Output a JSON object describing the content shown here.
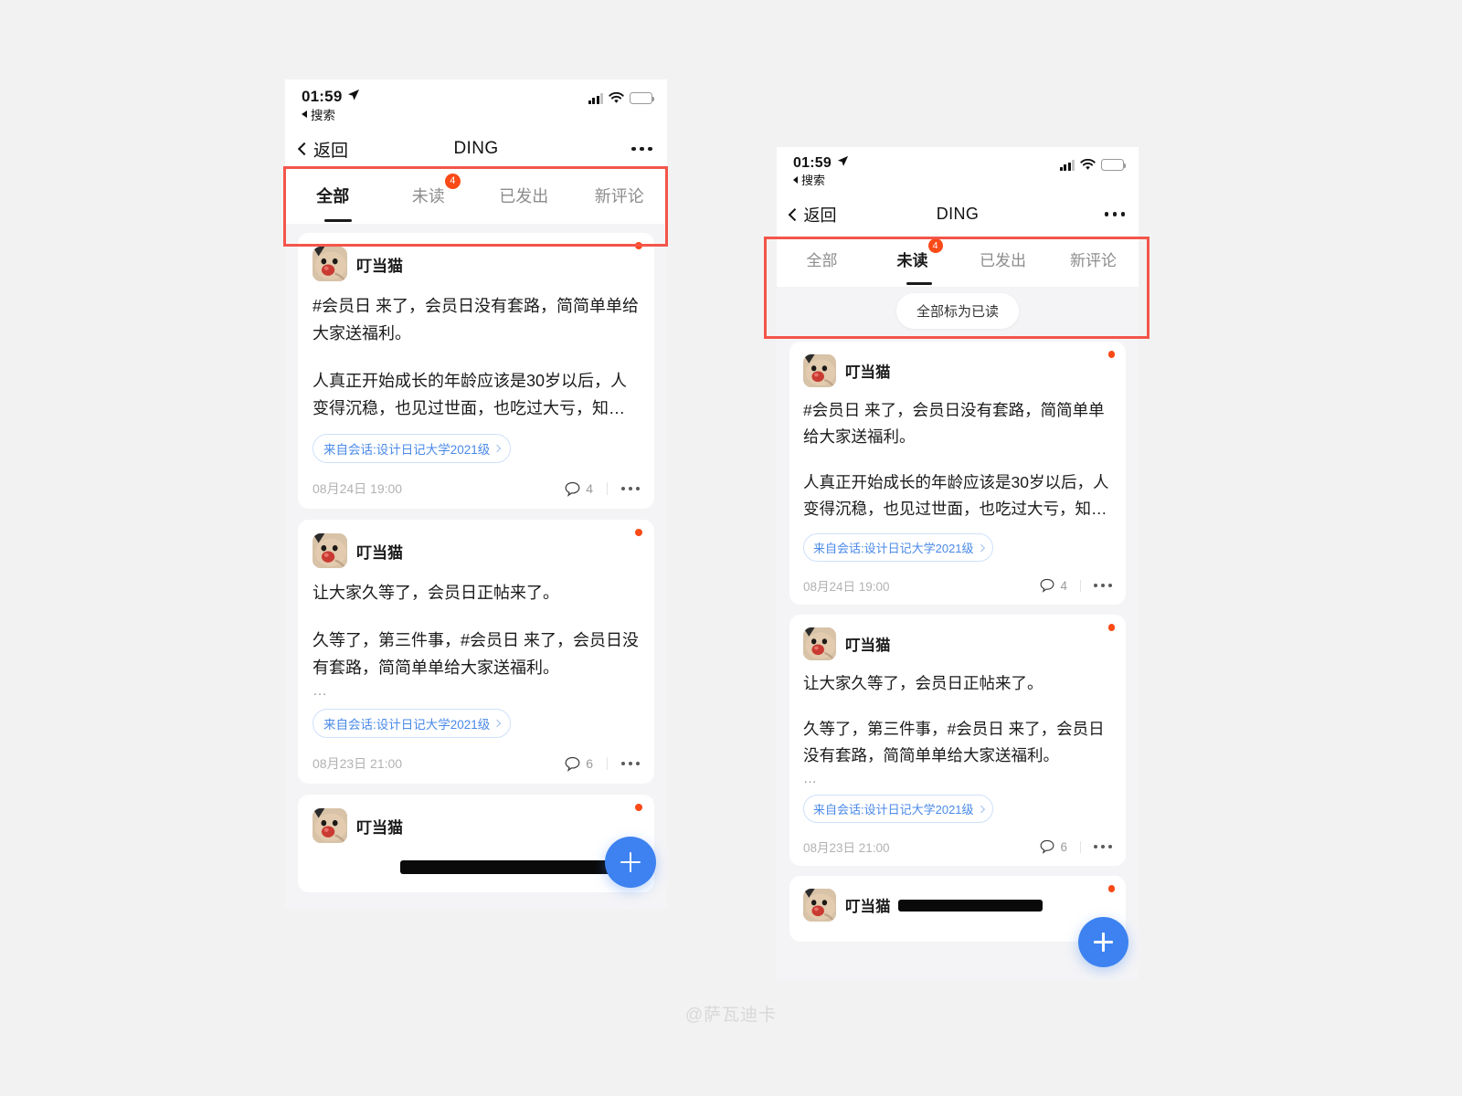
{
  "page": {
    "watermark": "@萨瓦迪卡",
    "accent_blue": "#3d82f0",
    "badge_orange": "#fa4a17",
    "annotation_red": "#f4554a",
    "background": "#f2f2f2"
  },
  "status_bar": {
    "time": "01:59",
    "location_icon": "location-arrow-icon",
    "back_label": "搜索",
    "back_icon": "back-triangle-icon",
    "signal_icon": "cellular-signal-icon",
    "wifi_icon": "wifi-icon",
    "battery_icon": "battery-charging-icon"
  },
  "nav": {
    "back_label": "返回",
    "back_icon": "chevron-left-icon",
    "title": "DING",
    "more_icon": "more-horizontal-icon"
  },
  "tabs": [
    {
      "label": "全部",
      "badge": "",
      "active_left": true,
      "active_right": false
    },
    {
      "label": "未读",
      "badge": "4",
      "active_left": false,
      "active_right": true
    },
    {
      "label": "已发出",
      "badge": "",
      "active_left": false,
      "active_right": false
    },
    {
      "label": "新评论",
      "badge": "",
      "active_left": false,
      "active_right": false
    }
  ],
  "mark_read": {
    "label": "全部标为已读"
  },
  "cards": [
    {
      "author": "叮当猫",
      "avatar_icon": "cat-avatar",
      "unread": true,
      "paragraphs": [
        "#会员日 来了，会员日没有套路，简简单单给大家送福利。",
        "人真正开始成长的年龄应该是30岁以后，人变得沉稳，也见过世面，也吃过大亏，知…"
      ],
      "has_ellipsis": false,
      "source": "来自会话:设计日记大学2021级",
      "source_chevron_icon": "chevron-right-icon",
      "time": "08月24日 19:00",
      "comment_count": "4",
      "comment_icon": "comment-bubble-icon",
      "more_icon": "more-horizontal-icon"
    },
    {
      "author": "叮当猫",
      "avatar_icon": "cat-avatar",
      "unread": true,
      "paragraphs": [
        "让大家久等了，会员日正帖来了。",
        "久等了，第三件事，#会员日  来了，会员日没有套路，简简单单给大家送福利。"
      ],
      "has_ellipsis": true,
      "ellipsis": "…",
      "source": "来自会话:设计日记大学2021级",
      "source_chevron_icon": "chevron-right-icon",
      "time": "08月23日 21:00",
      "comment_count": "6",
      "comment_icon": "comment-bubble-icon",
      "more_icon": "more-horizontal-icon"
    },
    {
      "author": "叮当猫",
      "avatar_icon": "cat-avatar",
      "unread": true,
      "redacted": true,
      "paragraphs": [],
      "source": "",
      "time": "",
      "comment_count": ""
    }
  ],
  "fab": {
    "icon": "plus-icon",
    "label": "+"
  }
}
